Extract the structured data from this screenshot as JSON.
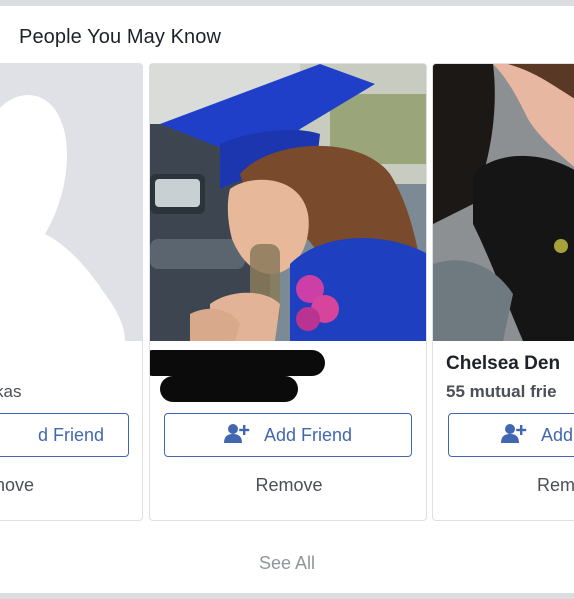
{
  "section": {
    "title": "People You May Know"
  },
  "cards": [
    {
      "name": "",
      "mutual": "kas",
      "add_label": "d Friend",
      "remove_label": "nove"
    },
    {
      "name": "",
      "mutual": "",
      "add_label": "Add Friend",
      "remove_label": "Remove"
    },
    {
      "name": "Chelsea Den",
      "mutual": "55 mutual frie",
      "add_label": "Add",
      "remove_label": "Rem"
    }
  ],
  "footer": {
    "see_all_label": "See All"
  },
  "colors": {
    "accent": "#4267b2",
    "text_dark": "#1d2129",
    "text_muted": "#90949c",
    "border": "#dddfe2"
  },
  "icons": {
    "add_friend": "add-friend-icon",
    "silhouette": "default-profile-silhouette"
  }
}
